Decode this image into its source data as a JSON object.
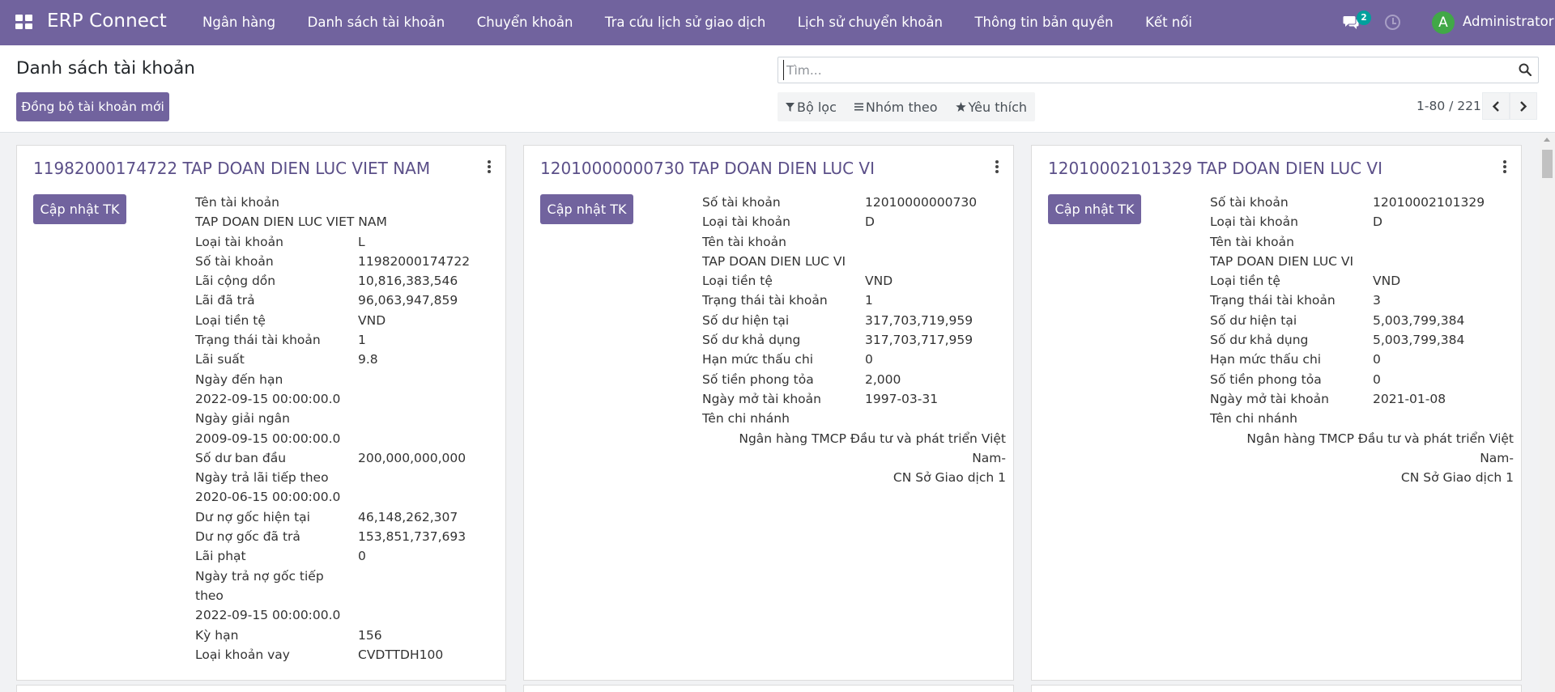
{
  "navbar": {
    "app_name": "ERP Connect",
    "menu": [
      "Ngân hàng",
      "Danh sách tài khoản",
      "Chuyển khoản",
      "Tra cứu lịch sử giao dịch",
      "Lịch sử chuyển khoản",
      "Thông tin bản quyền",
      "Kết nối"
    ],
    "message_count": "2",
    "user_initial": "A",
    "user_name": "Administrator",
    "colors": {
      "navbar": "#71639e",
      "avatar": "#41a847",
      "badge": "#00a09d"
    }
  },
  "control_panel": {
    "title": "Danh sách tài khoản",
    "sync_button": "Đồng bộ tài khoản mới",
    "search_placeholder": "Tìm...",
    "filters": [
      "Bộ lọc",
      "Nhóm theo",
      "Yêu thích"
    ],
    "pager_value": "1-80 / 221"
  },
  "cards": [
    {
      "title": "11982000174722 TAP DOAN DIEN LUC VIET NAM",
      "button": "Cập nhật TK",
      "fields": [
        {
          "type": "stack",
          "label": "Tên tài khoản",
          "value": "TAP DOAN DIEN LUC VIET NAM"
        },
        {
          "type": "row",
          "label": "Loại tài khoản",
          "value": "L"
        },
        {
          "type": "row",
          "label": "Số tài khoản",
          "value": "11982000174722"
        },
        {
          "type": "row",
          "label": "Lãi cộng dồn",
          "value": "10,816,383,546"
        },
        {
          "type": "row",
          "label": "Lãi đã trả",
          "value": "96,063,947,859"
        },
        {
          "type": "row",
          "label": "Loại tiền tệ",
          "value": "VND"
        },
        {
          "type": "row",
          "label": "Trạng thái tài khoản",
          "value": "1"
        },
        {
          "type": "row",
          "label": "Lãi suất",
          "value": "9.8"
        },
        {
          "type": "stack",
          "label": "Ngày đến hạn",
          "value": "2022-09-15 00:00:00.0"
        },
        {
          "type": "stack",
          "label": "Ngày giải ngân",
          "value": "2009-09-15 00:00:00.0"
        },
        {
          "type": "row",
          "label": "Số dư ban đầu",
          "value": "200,000,000,000"
        },
        {
          "type": "stack",
          "label": "Ngày trả lãi tiếp theo",
          "value": "2020-06-15 00:00:00.0"
        },
        {
          "type": "row",
          "label": "Dư nợ gốc hiện tại",
          "value": "46,148,262,307"
        },
        {
          "type": "row",
          "label": "Dư nợ gốc đã trả",
          "value": "153,851,737,693"
        },
        {
          "type": "row",
          "label": "Lãi phạt",
          "value": "0"
        },
        {
          "type": "stack2",
          "label": "Ngày trả nợ gốc tiếp",
          "label2": "theo",
          "value": "2022-09-15 00:00:00.0"
        },
        {
          "type": "row",
          "label": "Kỳ hạn",
          "value": "156"
        },
        {
          "type": "row",
          "label": "Loại khoản vay",
          "value": "CVDTTDH100"
        }
      ]
    },
    {
      "title": "12010000000730 TAP DOAN DIEN LUC VI",
      "button": "Cập nhật TK",
      "fields": [
        {
          "type": "row",
          "label": "Số tài khoản",
          "value": "12010000000730"
        },
        {
          "type": "row",
          "label": "Loại tài khoản",
          "value": "D"
        },
        {
          "type": "stack",
          "label": "Tên tài khoản",
          "value": "TAP DOAN DIEN LUC VI"
        },
        {
          "type": "row",
          "label": "Loại tiền tệ",
          "value": "VND"
        },
        {
          "type": "row",
          "label": "Trạng thái tài khoản",
          "value": "1"
        },
        {
          "type": "row",
          "label": "Số dư hiện tại",
          "value": "317,703,719,959"
        },
        {
          "type": "row",
          "label": "Số dư khả dụng",
          "value": "317,703,717,959"
        },
        {
          "type": "row",
          "label": "Hạn mức thấu chi",
          "value": "0"
        },
        {
          "type": "row",
          "label": "Số tiền phong tỏa",
          "value": "2,000"
        },
        {
          "type": "row",
          "label": "Ngày mở tài khoản",
          "value": "1997-03-31"
        },
        {
          "type": "right",
          "label": "Tên chi nhánh",
          "value": "Ngân hàng TMCP Đầu tư và phát triển Việt Nam-",
          "value2": "CN Sở Giao dịch 1"
        }
      ]
    },
    {
      "title": "12010002101329 TAP DOAN DIEN LUC VI",
      "button": "Cập nhật TK",
      "fields": [
        {
          "type": "row",
          "label": "Số tài khoản",
          "value": "12010002101329"
        },
        {
          "type": "row",
          "label": "Loại tài khoản",
          "value": "D"
        },
        {
          "type": "stack",
          "label": "Tên tài khoản",
          "value": "TAP DOAN DIEN LUC VI"
        },
        {
          "type": "row",
          "label": "Loại tiền tệ",
          "value": "VND"
        },
        {
          "type": "row",
          "label": "Trạng thái tài khoản",
          "value": "3"
        },
        {
          "type": "row",
          "label": "Số dư hiện tại",
          "value": "5,003,799,384"
        },
        {
          "type": "row",
          "label": "Số dư khả dụng",
          "value": "5,003,799,384"
        },
        {
          "type": "row",
          "label": "Hạn mức thấu chi",
          "value": "0"
        },
        {
          "type": "row",
          "label": "Số tiền phong tỏa",
          "value": "0"
        },
        {
          "type": "row",
          "label": "Ngày mở tài khoản",
          "value": "2021-01-08"
        },
        {
          "type": "right",
          "label": "Tên chi nhánh",
          "value": "Ngân hàng TMCP Đầu tư và phát triển Việt Nam-",
          "value2": "CN Sở Giao dịch 1"
        }
      ]
    }
  ]
}
